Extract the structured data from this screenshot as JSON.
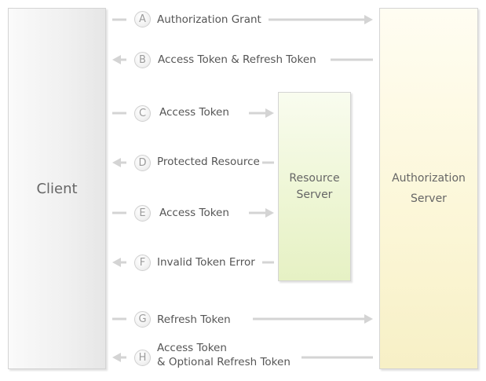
{
  "nodes": {
    "client": "Client",
    "resource_server": "Resource\nServer",
    "authorization_server": "Authorization\nServer"
  },
  "steps": [
    {
      "letter": "A",
      "label": "Authorization Grant"
    },
    {
      "letter": "B",
      "label": "Access Token & Refresh Token"
    },
    {
      "letter": "C",
      "label": "Access Token"
    },
    {
      "letter": "D",
      "label": "Protected Resource"
    },
    {
      "letter": "E",
      "label": "Access Token"
    },
    {
      "letter": "F",
      "label": "Invalid Token Error"
    },
    {
      "letter": "G",
      "label": "Refresh Token"
    },
    {
      "letter": "H",
      "label": "Access Token\n& Optional Refresh Token"
    }
  ],
  "colors": {
    "arrow": "#d4d4d4",
    "text": "#555555",
    "resource_fill": "#eef6d5",
    "auth_fill": "#fcf7d9",
    "client_fill": "#f0f0f0"
  }
}
